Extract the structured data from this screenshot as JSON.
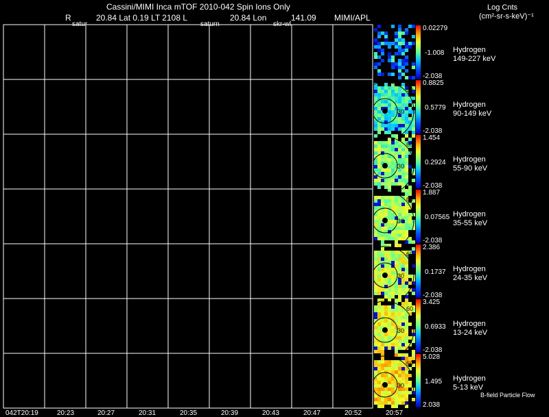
{
  "header": {
    "title": "Cassini/MIMI Inca mTOF  2010-042   Spin    Ions Only",
    "r_label": "R",
    "position": "20.84 Lat 0.19 LT 2108 L",
    "lon": "20.84 Lon",
    "lon_value": "141.09",
    "institution": "MIMI/APL",
    "marker_satur": "satur",
    "marker_saturn": "saturn",
    "marker_skr": "skr-wl",
    "units_line1": "Log Cnts",
    "units_line2": "(cm²-sr-s-keV)⁻¹"
  },
  "footer": {
    "bfield_label": "B-field Particle Flow"
  },
  "time_axis": {
    "ticks": [
      "042T20:19",
      "20:23",
      "20:27",
      "20:31",
      "20:35",
      "20:39",
      "20:43",
      "20:47",
      "20:52",
      "20:57"
    ]
  },
  "chart_data": {
    "type": "heatmap",
    "title": "Cassini/MIMI Inca mTOF  2010-042   Spin    Ions Only",
    "xlabel": "",
    "ylabel": "",
    "grid": true,
    "colorbar_units": "Log Cnts (cm²-sr-s-keV)⁻¹",
    "sky_map_ring_labels": [
      "30",
      "60"
    ],
    "panels": [
      {
        "species": "Hydrogen",
        "energy": "149-227 keV",
        "cb_max": "0.02279",
        "cb_mid": "-1.008",
        "cb_min": "-2.038",
        "level": 0.15
      },
      {
        "species": "Hydrogen",
        "energy": "90-149 keV",
        "cb_max": "0.8825",
        "cb_mid": "0.5779",
        "cb_min": "-2.038",
        "level": 0.45
      },
      {
        "species": "Hydrogen",
        "energy": "55-90 keV",
        "cb_max": "1.454",
        "cb_mid": "0.2924",
        "cb_min": "-2.038",
        "level": 0.55
      },
      {
        "species": "Hydrogen",
        "energy": "35-55 keV",
        "cb_max": "1.887",
        "cb_mid": "0.07565",
        "cb_min": "-2.038",
        "level": 0.6
      },
      {
        "species": "Hydrogen",
        "energy": "24-35 keV",
        "cb_max": "2.386",
        "cb_mid": "0.1737",
        "cb_min": "-2.038",
        "level": 0.64
      },
      {
        "species": "Hydrogen",
        "energy": "13-24 keV",
        "cb_max": "3.425",
        "cb_mid": "0.6933",
        "cb_min": "-2.038",
        "level": 0.68
      },
      {
        "species": "Hydrogen",
        "energy": "5-13 keV",
        "cb_max": "5.028",
        "cb_mid": "1.495",
        "cb_min": "2.038",
        "level": 0.74
      }
    ]
  }
}
